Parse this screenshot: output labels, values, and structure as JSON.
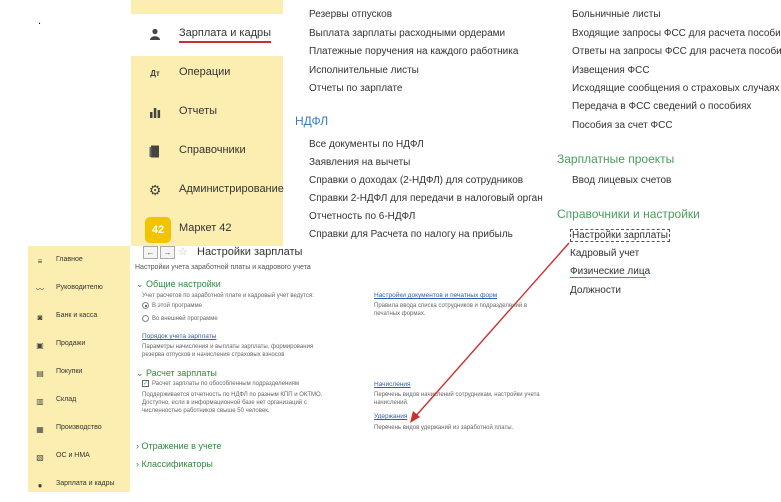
{
  "misc": {
    "dot": "."
  },
  "top": {
    "sidebar": [
      {
        "icon": "person-icon",
        "label": "Зарплата и кадры",
        "active": true
      },
      {
        "icon": "operations-icon",
        "label": "Операции"
      },
      {
        "icon": "bar-chart-icon",
        "label": "Отчеты"
      },
      {
        "icon": "book-icon",
        "label": "Справочники"
      },
      {
        "icon": "gear-icon",
        "label": "Администрирование"
      },
      {
        "icon": "market-42-icon",
        "badge": "42",
        "label": "Маркет 42"
      }
    ],
    "col1_items": [
      "Резервы отпусков",
      "Выплата зарплаты расходными ордерами",
      "Платежные поручения на каждого работника",
      "Исполнительные листы",
      "Отчеты по зарплате"
    ],
    "ndfl": {
      "header": "НДФЛ",
      "items": [
        "Все документы по НДФЛ",
        "Заявления на вычеты",
        "Справки о доходах (2-НДФЛ) для сотрудников",
        "Справки 2-НДФЛ для передачи в налоговый орган",
        "Отчетность по 6-НДФЛ",
        "Справки для Расчета по налогу на прибыль"
      ]
    },
    "col2_items": [
      "Больничные листы",
      "Входящие запросы ФСС для расчета пособий",
      "Ответы на запросы ФСС для расчета пособий",
      "Извещения ФСС",
      "Исходящие сообщения о страховых случаях ФСС",
      "Передача в ФСС сведений о пособиях",
      "Пособия за счет ФСС"
    ],
    "projects": {
      "header": "Зарплатные проекты",
      "items": [
        "Ввод лицевых счетов"
      ]
    },
    "settings": {
      "header": "Справочники и настройки",
      "items": [
        "Настройки зарплаты",
        "Кадровый учет",
        "Физические лица",
        "Должности"
      ]
    }
  },
  "bottom": {
    "sidebar": [
      {
        "icon": "menu-icon",
        "label": "Главное"
      },
      {
        "icon": "trend-icon",
        "label": "Руководителю"
      },
      {
        "icon": "bank-icon",
        "label": "Банк и касса"
      },
      {
        "icon": "cart-icon",
        "label": "Продажи"
      },
      {
        "icon": "bag-icon",
        "label": "Покупки"
      },
      {
        "icon": "warehouse-icon",
        "label": "Склад"
      },
      {
        "icon": "factory-icon",
        "label": "Производство"
      },
      {
        "icon": "assets-icon",
        "label": "ОС и НМА"
      },
      {
        "icon": "person-icon",
        "label": "Зарплата и кадры"
      }
    ],
    "form": {
      "back": "←",
      "forward": "→",
      "star": "☆",
      "title": "Настройки зарплаты",
      "subtitle": "Настройки учета заработной платы и кадрового учета",
      "general": {
        "header": "Общие настройки",
        "note": "Учет расчетов по заработной плате и кадровый учет ведутся:",
        "radio1": "В этой программе",
        "radio2": "Во внешней программе",
        "link": "Порядок учета зарплаты",
        "desc1": "Параметры начисления и выплаты зарплаты, формирования",
        "desc2": "резерва отпусков и начисления страховых взносов",
        "docs_link": "Настройки документов и печатных форм",
        "docs_desc1": "Правила ввода списка сотрудников и подразделений в",
        "docs_desc2": "печатных формах."
      },
      "calc": {
        "header": "Расчет зарплаты",
        "checkbox": "Расчет зарплаты по обособленным подразделениям",
        "desc1": "Поддерживается отчетность по НДФЛ по разным КПП и ОКТМО.",
        "desc2": "Доступно, если в информационной базе нет организаций с",
        "desc3": "численностью работников свыше 50 человек.",
        "accruals_link": "Начисления",
        "accruals_desc1": "Перечень видов начислений сотрудникам, настройки учета",
        "accruals_desc2": "начислений.",
        "deductions_link": "Удержания",
        "deductions_desc": "Перечень видов удержаний из заработной платы."
      },
      "reflection": "Отражение в учете",
      "classifiers": "Классификаторы"
    }
  },
  "colors": {
    "accent_red": "#c8302f",
    "green": "#4a9d5b",
    "sidebar": "#fbeeb0"
  }
}
